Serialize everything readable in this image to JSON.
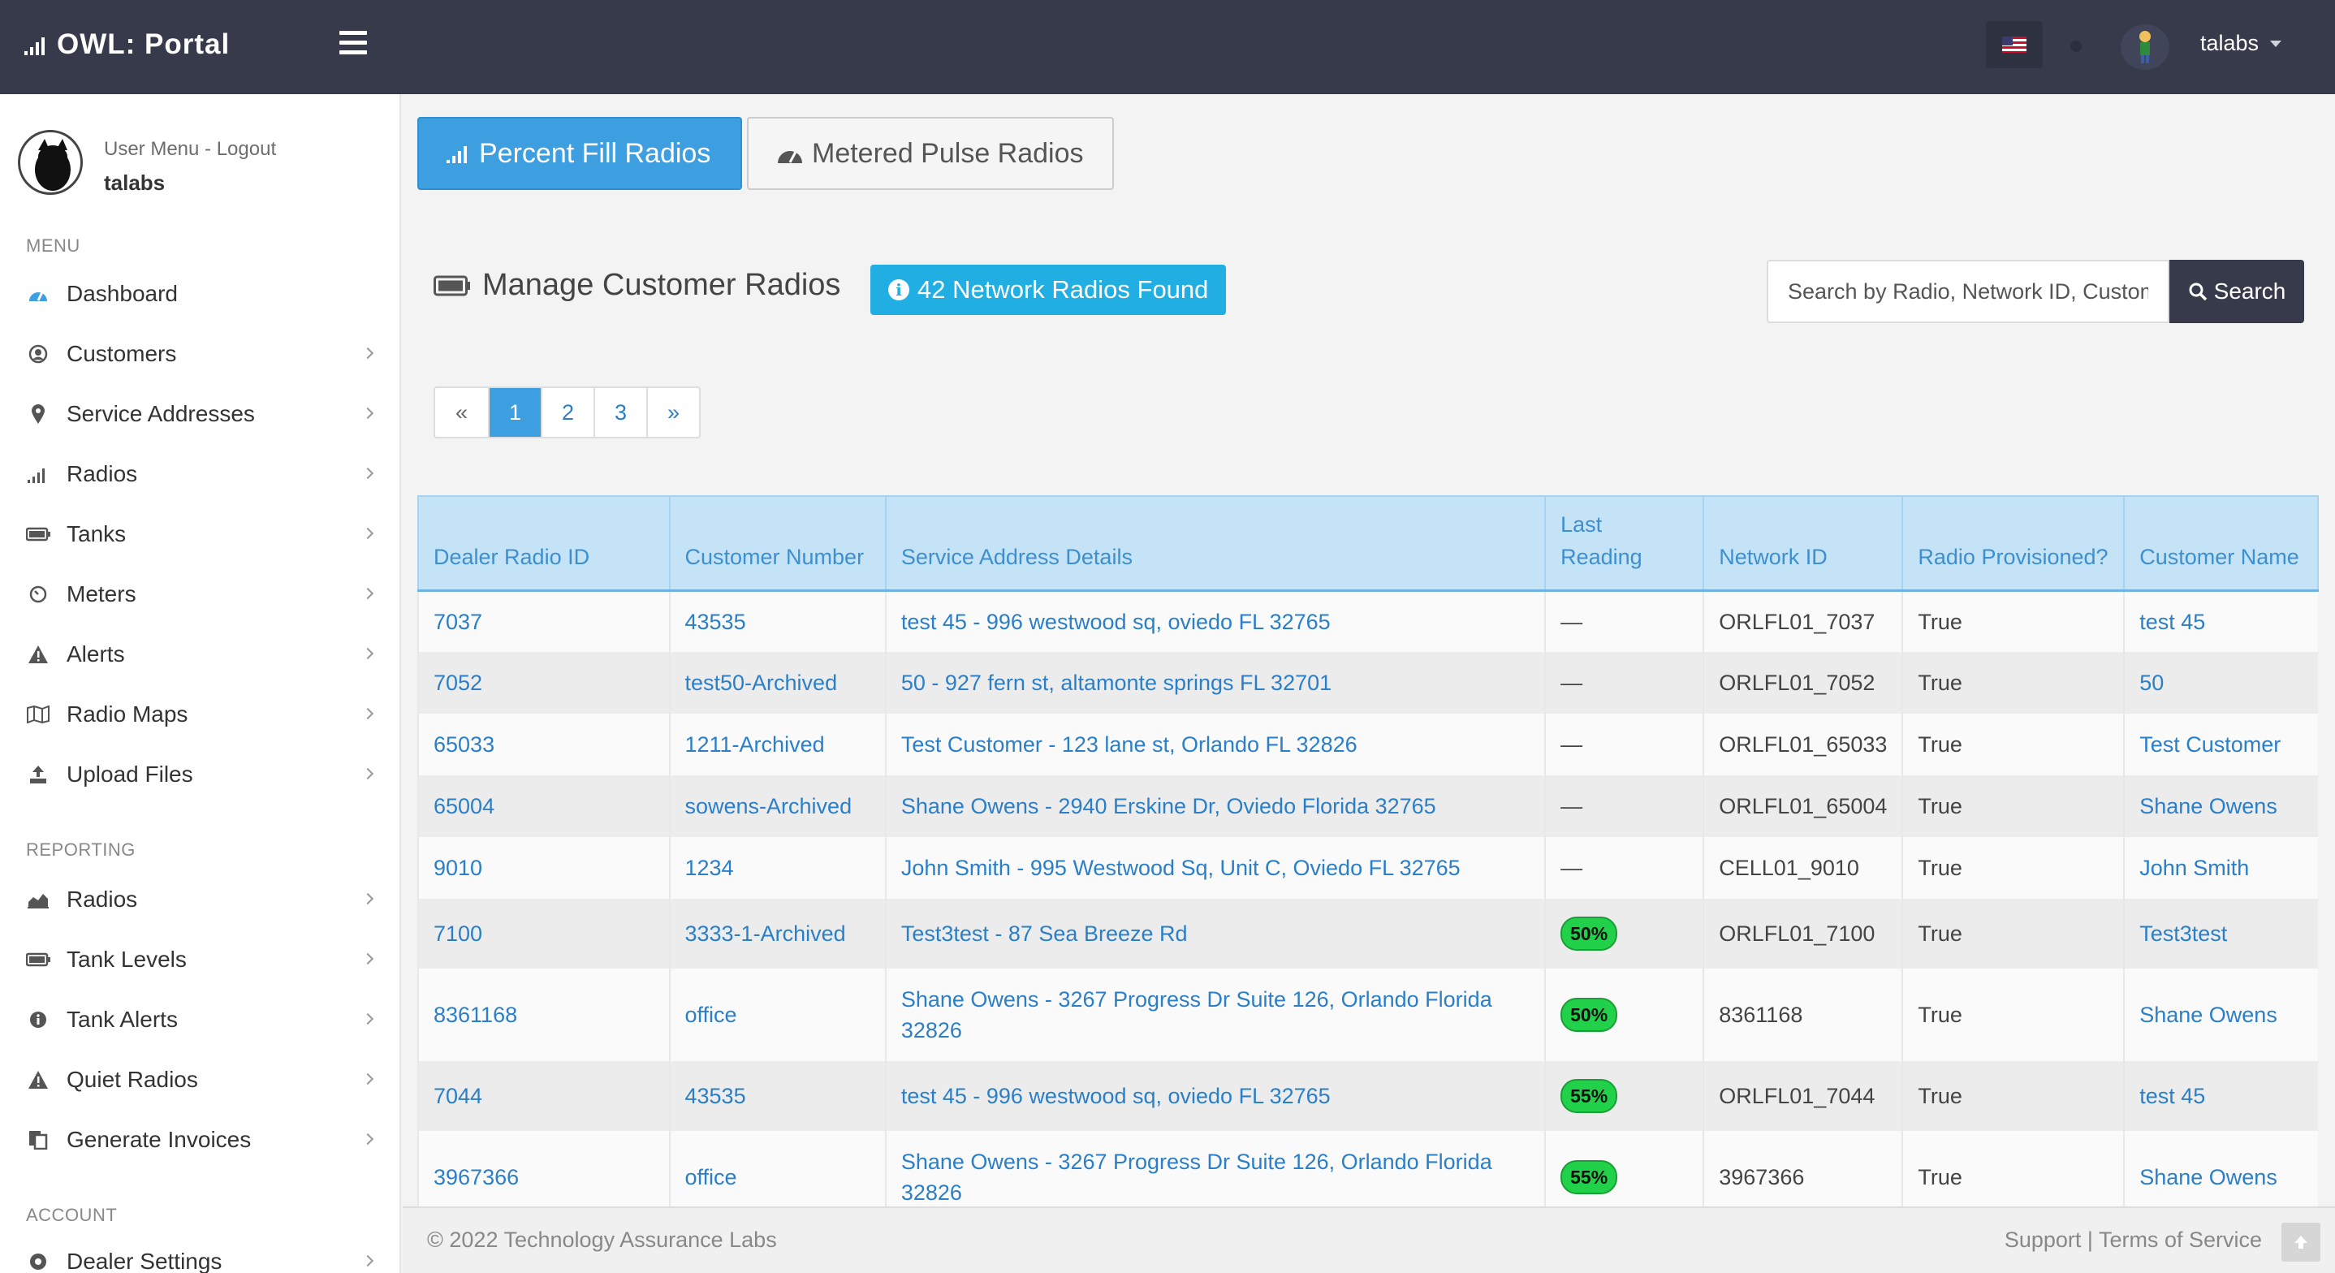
{
  "app": {
    "title": "OWL: Portal"
  },
  "topbar": {
    "username": "talabs"
  },
  "profile": {
    "menu_label": "User Menu - Logout",
    "name": "talabs"
  },
  "sidebar": {
    "menu_label": "MENU",
    "menu_items": [
      "Dashboard",
      "Customers",
      "Service Addresses",
      "Radios",
      "Tanks",
      "Meters",
      "Alerts",
      "Radio Maps",
      "Upload Files"
    ],
    "reporting_label": "REPORTING",
    "reporting_items": [
      "Radios",
      "Tank Levels",
      "Tank Alerts",
      "Quiet Radios",
      "Generate Invoices"
    ],
    "account_label": "ACCOUNT",
    "account_items": [
      "Dealer Settings"
    ]
  },
  "tabs": [
    {
      "label": "Percent Fill Radios",
      "icon": "signal-bars-icon",
      "active": true
    },
    {
      "label": "Metered Pulse Radios",
      "icon": "gauge-icon",
      "active": false
    }
  ],
  "manage": {
    "title": "Manage Customer Radios",
    "found_badge": "42 Network Radios Found"
  },
  "search": {
    "placeholder": "Search by Radio, Network ID, Customer",
    "button_label": "Search"
  },
  "pagination": {
    "prev": "«",
    "pages": [
      "1",
      "2",
      "3"
    ],
    "next": "»",
    "current": "1"
  },
  "table": {
    "headers": [
      "Dealer Radio ID",
      "Customer Number",
      "Service Address Details",
      "Last Reading",
      "Network ID",
      "Radio Provisioned?",
      "Customer Name"
    ],
    "rows": [
      [
        "7037",
        "43535",
        "test 45 - 996 westwood sq, oviedo FL 32765",
        "—",
        "ORLFL01_7037",
        "True",
        "test 45"
      ],
      [
        "7052",
        "test50-Archived",
        "50 - 927 fern st, altamonte springs FL 32701",
        "—",
        "ORLFL01_7052",
        "True",
        "50"
      ],
      [
        "65033",
        "1211-Archived",
        "Test Customer - 123 lane st, Orlando FL 32826",
        "—",
        "ORLFL01_65033",
        "True",
        "Test Customer"
      ],
      [
        "65004",
        "sowens-Archived",
        "Shane Owens - 2940 Erskine Dr, Oviedo Florida 32765",
        "—",
        "ORLFL01_65004",
        "True",
        "Shane Owens"
      ],
      [
        "9010",
        "1234",
        "John Smith - 995 Westwood Sq, Unit C, Oviedo FL 32765",
        "—",
        "CELL01_9010",
        "True",
        "John Smith"
      ],
      [
        "7100",
        "3333-1-Archived",
        "Test3test - 87 Sea Breeze Rd",
        "50%",
        "ORLFL01_7100",
        "True",
        "Test3test"
      ],
      [
        "8361168",
        "office",
        "Shane Owens - 3267 Progress Dr Suite 126, Orlando Florida 32826",
        "50%",
        "8361168",
        "True",
        "Shane Owens"
      ],
      [
        "7044",
        "43535",
        "test 45 - 996 westwood sq, oviedo FL 32765",
        "55%",
        "ORLFL01_7044",
        "True",
        "test 45"
      ],
      [
        "3967366",
        "office",
        "Shane Owens - 3267 Progress Dr Suite 126, Orlando Florida 32826",
        "55%",
        "3967366",
        "True",
        "Shane Owens"
      ]
    ]
  },
  "footer": {
    "copyright": "© 2022 Technology Assurance Labs",
    "support": "Support",
    "separator": "|",
    "terms": "Terms of Service"
  },
  "colors": {
    "topbar": "#373a4b",
    "accent": "#3d9ee0",
    "badge": "#20aee3",
    "fill_badge": "#22d14a"
  }
}
